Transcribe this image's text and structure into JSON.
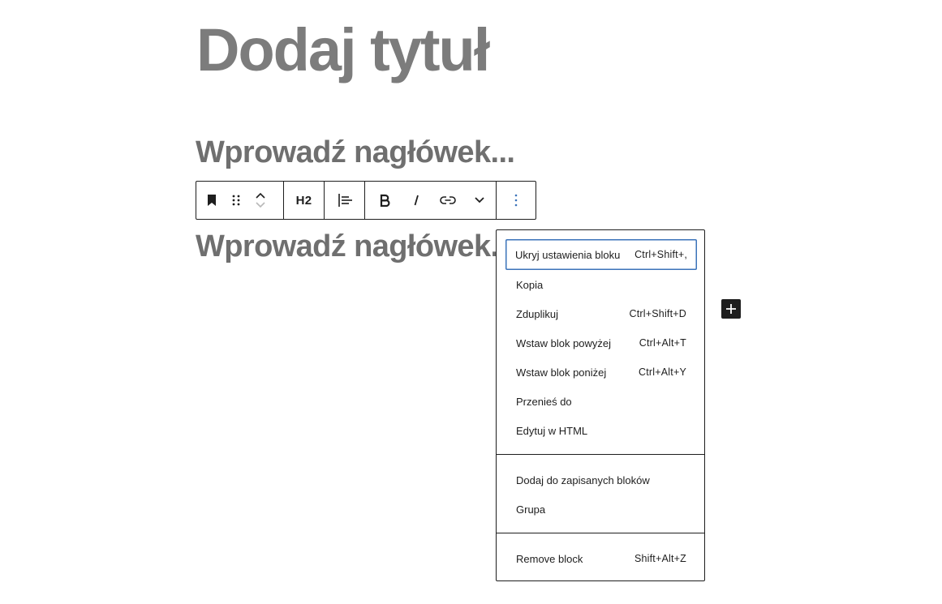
{
  "editor": {
    "title_placeholder": "Dodaj tytuł",
    "heading_placeholder_1": "Wprowadź nagłówek...",
    "heading_placeholder_2": "Wprowadź nagłówek..."
  },
  "toolbar": {
    "block_type_icon": "bookmark-icon",
    "drag_icon": "drag-handle-icon",
    "move_up_icon": "chevron-up-icon",
    "move_down_icon": "chevron-down-icon",
    "heading_level": "H2",
    "align_icon": "align-left-icon",
    "bold_icon": "bold-icon",
    "italic_icon": "italic-icon",
    "link_icon": "link-icon",
    "more_rich_text_icon": "chevron-down-icon",
    "options_icon": "more-vertical-icon"
  },
  "menu": {
    "section1": [
      {
        "label": "Ukryj ustawienia bloku",
        "shortcut": "Ctrl+Shift+,"
      },
      {
        "label": "Kopia",
        "shortcut": ""
      },
      {
        "label": "Zduplikuj",
        "shortcut": "Ctrl+Shift+D"
      },
      {
        "label": "Wstaw blok powyżej",
        "shortcut": "Ctrl+Alt+T"
      },
      {
        "label": "Wstaw blok poniżej",
        "shortcut": "Ctrl+Alt+Y"
      },
      {
        "label": "Przenieś do",
        "shortcut": ""
      },
      {
        "label": "Edytuj w HTML",
        "shortcut": ""
      }
    ],
    "section2": [
      {
        "label": "Dodaj do zapisanych bloków",
        "shortcut": ""
      },
      {
        "label": "Grupa",
        "shortcut": ""
      }
    ],
    "section3": [
      {
        "label": "Remove block",
        "shortcut": "Shift+Alt+Z"
      }
    ]
  },
  "inserter": {
    "icon": "plus-icon"
  },
  "colors": {
    "text": "#1e1e1e",
    "placeholder": "#7c7c7c",
    "focus": "#3b73b9"
  }
}
